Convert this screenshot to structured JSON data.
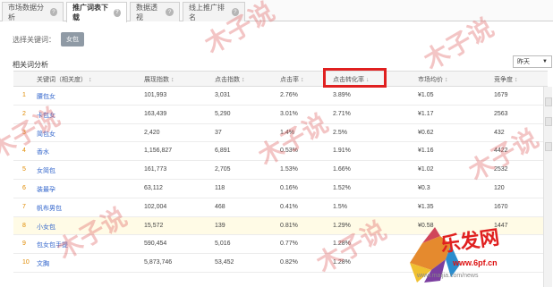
{
  "tabs": [
    {
      "label": "市场数据分析",
      "active": false
    },
    {
      "label": "推广词表下载",
      "active": true
    },
    {
      "label": "数据透视",
      "active": false
    },
    {
      "label": "线上推广排名",
      "active": false
    }
  ],
  "filter": {
    "label": "选择关键词：",
    "selected": "女包"
  },
  "section_title": "相关词分析",
  "period": {
    "selected": "昨天"
  },
  "columns": [
    "关键词（相关度）",
    "展现指数",
    "点击指数",
    "点击率",
    "点击转化率",
    "市场均价",
    "竞争度"
  ],
  "rows": [
    {
      "rank": "1",
      "keyword": "腰包女",
      "impressions": "101,993",
      "clicks": "3,031",
      "ctr": "2.76%",
      "cvr": "3.89%",
      "price": "¥1.05",
      "competition": "1679"
    },
    {
      "rank": "2",
      "keyword": "卡包女",
      "impressions": "163,439",
      "clicks": "5,290",
      "ctr": "3.01%",
      "cvr": "2.71%",
      "price": "¥1.17",
      "competition": "2563"
    },
    {
      "rank": "3",
      "keyword": "简包女",
      "impressions": "2,420",
      "clicks": "37",
      "ctr": "1.4%",
      "cvr": "2.5%",
      "price": "¥0.62",
      "competition": "432"
    },
    {
      "rank": "4",
      "keyword": "香水",
      "impressions": "1,156,827",
      "clicks": "6,891",
      "ctr": "0.53%",
      "cvr": "1.91%",
      "price": "¥1.16",
      "competition": "4422"
    },
    {
      "rank": "5",
      "keyword": "女简包",
      "impressions": "161,773",
      "clicks": "2,705",
      "ctr": "1.53%",
      "cvr": "1.66%",
      "price": "¥1.02",
      "competition": "2532"
    },
    {
      "rank": "6",
      "keyword": "装最孕",
      "impressions": "63,112",
      "clicks": "118",
      "ctr": "0.16%",
      "cvr": "1.52%",
      "price": "¥0.3",
      "competition": "120"
    },
    {
      "rank": "7",
      "keyword": "帆布男包",
      "impressions": "102,004",
      "clicks": "468",
      "ctr": "0.41%",
      "cvr": "1.5%",
      "price": "¥1.35",
      "competition": "1670"
    },
    {
      "rank": "8",
      "keyword": "小女包",
      "impressions": "15,572",
      "clicks": "139",
      "ctr": "0.81%",
      "cvr": "1.29%",
      "price": "¥0.58",
      "competition": "1447"
    },
    {
      "rank": "9",
      "keyword": "包女包手提",
      "impressions": "590,454",
      "clicks": "5,016",
      "ctr": "0.77%",
      "cvr": "1.28%",
      "price": "",
      "competition": ""
    },
    {
      "rank": "10",
      "keyword": "文胸",
      "impressions": "5,873,746",
      "clicks": "53,452",
      "ctr": "0.82%",
      "cvr": "1.28%",
      "price": "",
      "competition": ""
    }
  ],
  "watermark": "木子说",
  "logo": {
    "text": "乐发网",
    "url": "www.6pf.cn",
    "sub": "www.maijia.com/news"
  },
  "colors": {
    "highlight_box": "#e02020",
    "keyword_link": "#3366cc",
    "rank": "#e08a00"
  }
}
